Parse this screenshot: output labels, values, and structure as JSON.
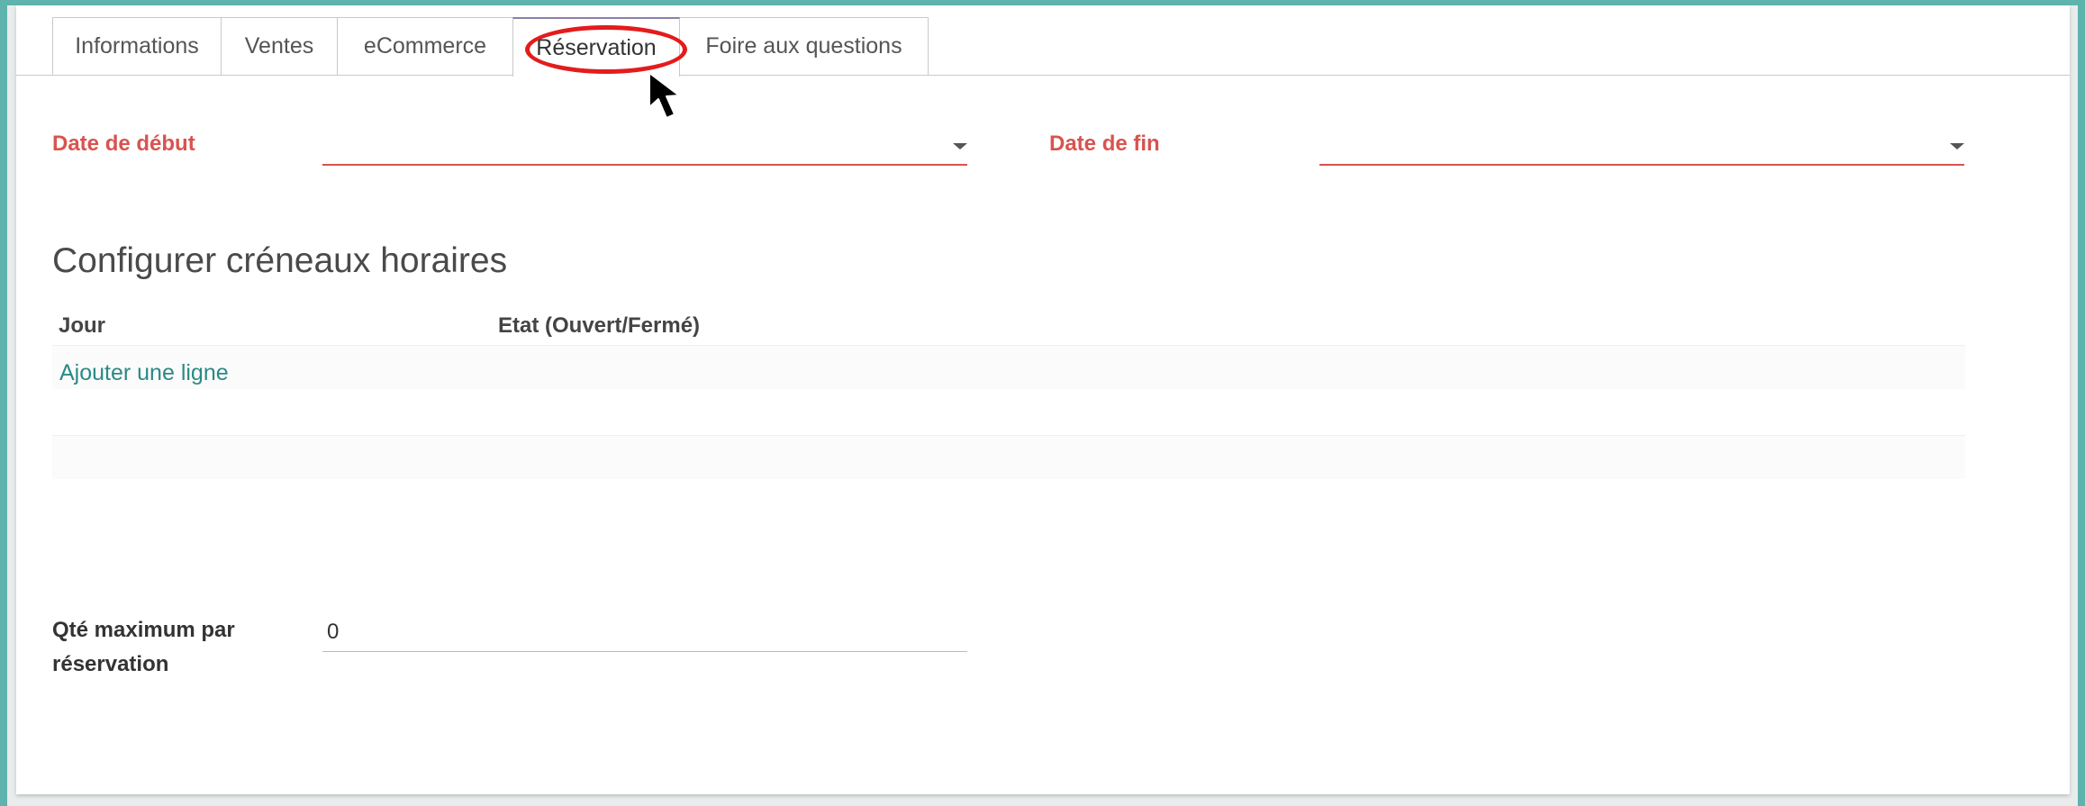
{
  "tabs": [
    {
      "label": "Informations",
      "active": false
    },
    {
      "label": "Ventes",
      "active": false
    },
    {
      "label": "eCommerce",
      "active": false
    },
    {
      "label": "Réservation",
      "active": true
    },
    {
      "label": "Foire aux questions",
      "active": false
    }
  ],
  "dates": {
    "start_label": "Date de début",
    "start_value": "",
    "end_label": "Date de fin",
    "end_value": ""
  },
  "slots": {
    "title": "Configurer créneaux horaires",
    "col_day": "Jour",
    "col_state": "Etat (Ouvert/Fermé)",
    "add_line": "Ajouter une ligne"
  },
  "qty": {
    "label_line1": "Qté maximum par",
    "label_line2": "réservation",
    "value": "0"
  },
  "colors": {
    "required": "#d9534f",
    "link": "#2b8a85",
    "highlight": "#e31c1c",
    "background": "#5fb3ad"
  },
  "icons": {
    "cursor": "arrow-cursor-icon",
    "dropdown": "caret-down-icon"
  }
}
